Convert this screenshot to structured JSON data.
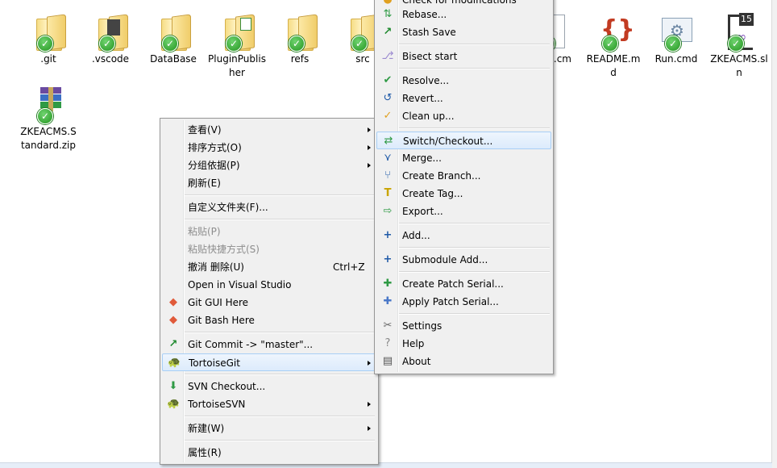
{
  "files": [
    {
      "label": ".git",
      "type": "folder"
    },
    {
      "label": ".vscode",
      "type": "folder"
    },
    {
      "label": "DataBase",
      "type": "folder"
    },
    {
      "label": "PluginPublisher",
      "type": "folder"
    },
    {
      "label": "refs",
      "type": "folder"
    },
    {
      "label": "src",
      "type": "folder"
    },
    {
      "label": "h.cm",
      "type": "doc"
    },
    {
      "label": "README.md",
      "type": "doc"
    },
    {
      "label": "Run.cmd",
      "type": "doc"
    },
    {
      "label": "ZKEACMS.sln",
      "type": "doc",
      "badge": "15"
    },
    {
      "label": "ZKEACMS.Standard.zip",
      "type": "archive"
    }
  ],
  "context_menu": {
    "items": [
      {
        "label": "查看(V)",
        "submenu": true
      },
      {
        "label": "排序方式(O)",
        "submenu": true
      },
      {
        "label": "分组依据(P)",
        "submenu": true
      },
      {
        "label": "刷新(E)"
      },
      {
        "label": "自定义文件夹(F)..."
      },
      {
        "label": "粘贴(P)",
        "disabled": true
      },
      {
        "label": "粘贴快捷方式(S)",
        "disabled": true
      },
      {
        "label": "撤消 删除(U)",
        "shortcut": "Ctrl+Z"
      },
      {
        "label": "Open in Visual Studio"
      },
      {
        "label": "Git GUI Here"
      },
      {
        "label": "Git Bash Here"
      },
      {
        "label": "Git Commit -> \"master\"..."
      },
      {
        "label": "TortoiseGit",
        "submenu": true
      },
      {
        "label": "SVN Checkout..."
      },
      {
        "label": "TortoiseSVN",
        "submenu": true
      },
      {
        "label": "新建(W)",
        "submenu": true
      },
      {
        "label": "属性(R)"
      }
    ]
  },
  "tortoisegit_menu": {
    "items": [
      {
        "label": "Check for modifications"
      },
      {
        "label": "Rebase..."
      },
      {
        "label": "Stash Save"
      },
      {
        "label": "Bisect start"
      },
      {
        "label": "Resolve..."
      },
      {
        "label": "Revert..."
      },
      {
        "label": "Clean up..."
      },
      {
        "label": "Switch/Checkout..."
      },
      {
        "label": "Merge..."
      },
      {
        "label": "Create Branch..."
      },
      {
        "label": "Create Tag..."
      },
      {
        "label": "Export..."
      },
      {
        "label": "Add..."
      },
      {
        "label": "Submodule Add..."
      },
      {
        "label": "Create Patch Serial..."
      },
      {
        "label": "Apply Patch Serial..."
      },
      {
        "label": "Settings"
      },
      {
        "label": "Help"
      },
      {
        "label": "About"
      }
    ]
  }
}
